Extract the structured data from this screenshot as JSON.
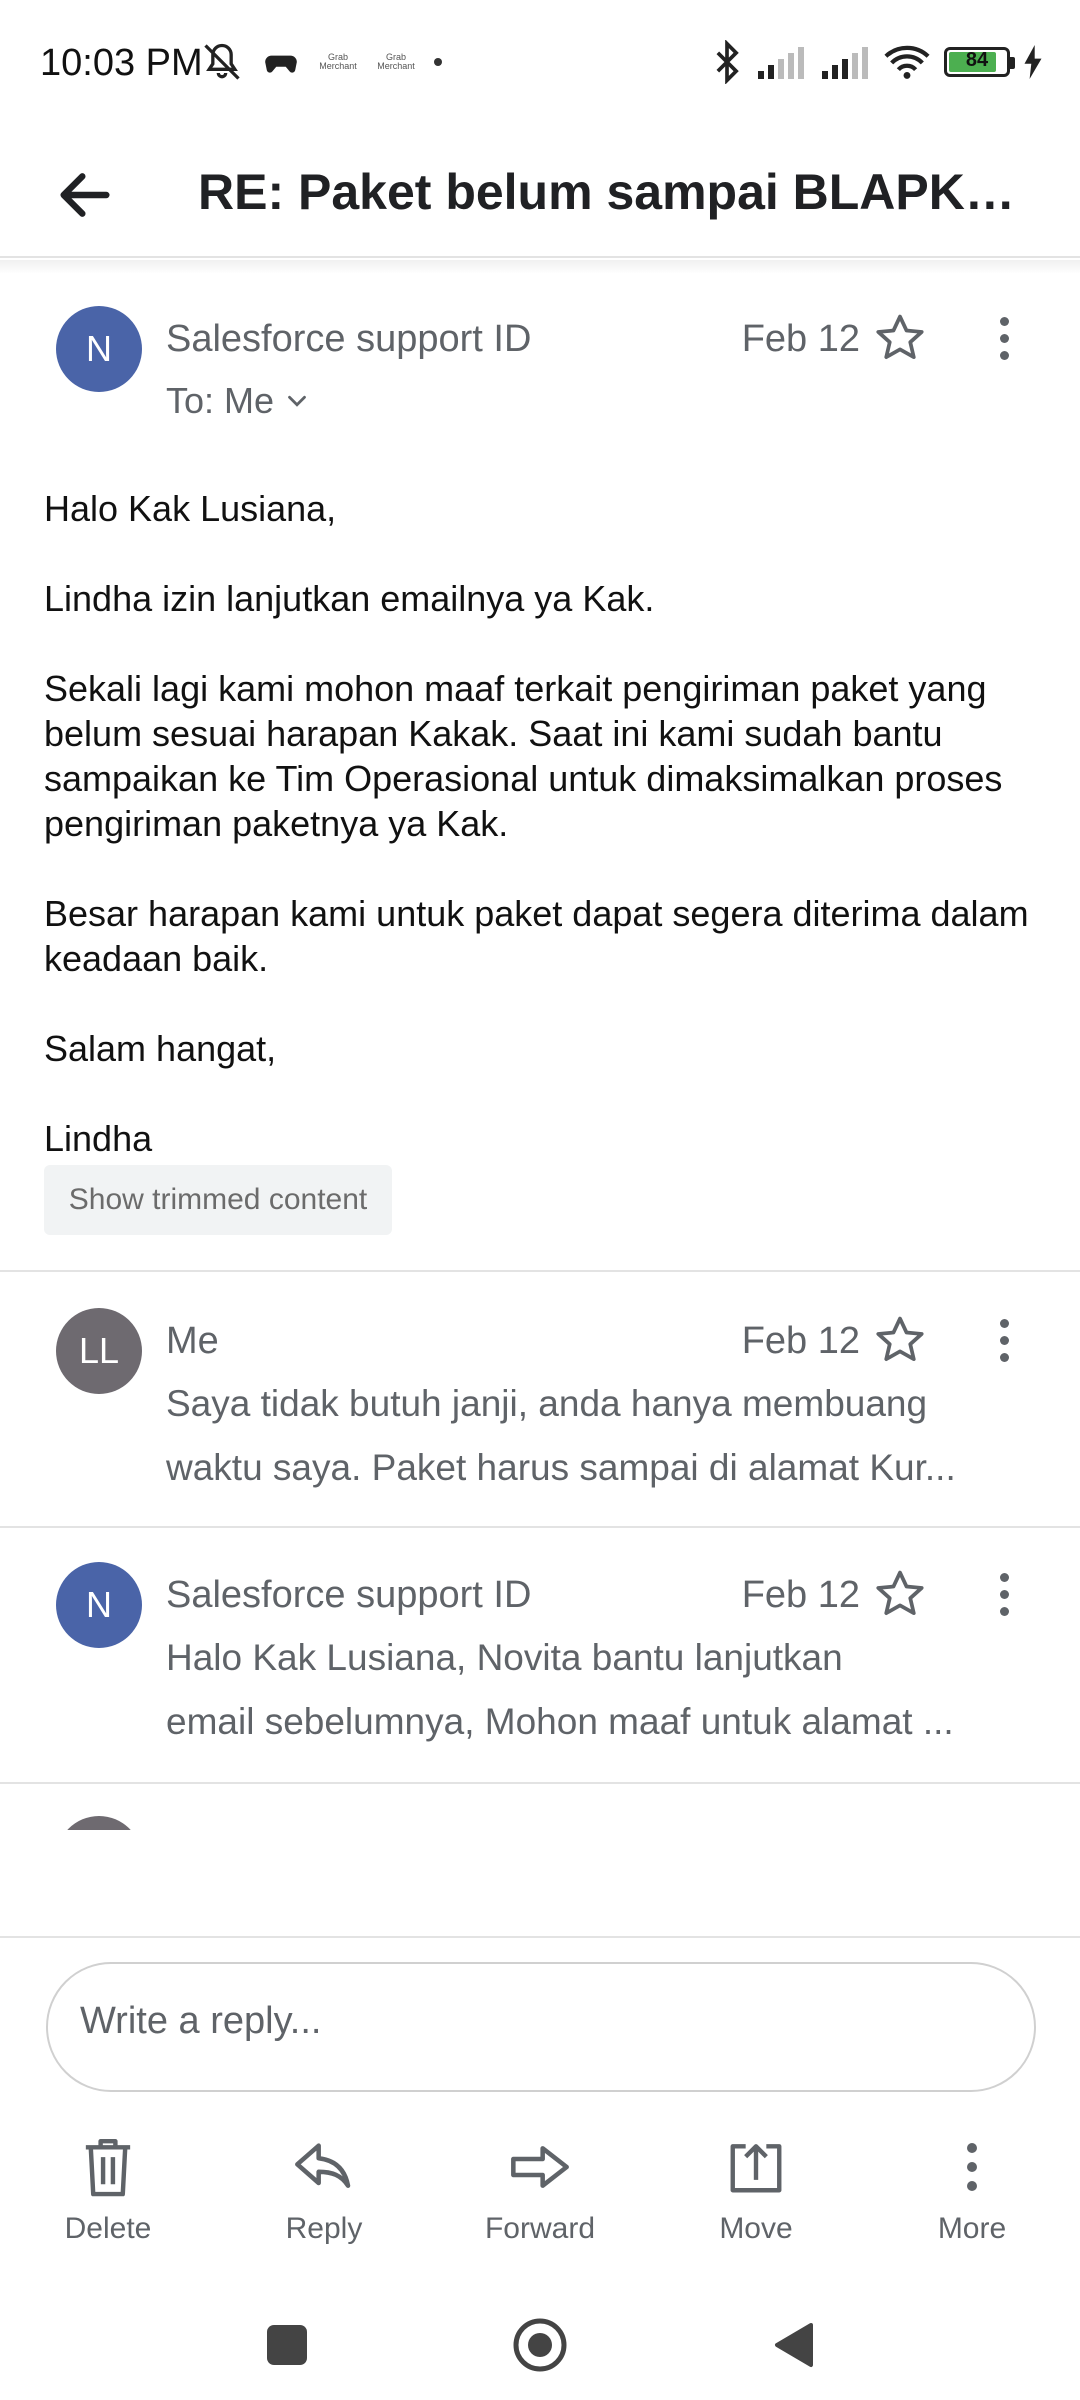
{
  "status_bar": {
    "time": "10:03 PM",
    "notif_labels": [
      "Grab Merchant",
      "Grab Merchant"
    ],
    "battery": "84",
    "icons": [
      "mute-icon",
      "game-controller-icon",
      "bluetooth-icon",
      "signal-icon",
      "signal-icon",
      "wifi-icon",
      "battery-icon",
      "charging-icon"
    ]
  },
  "app_bar": {
    "title": "RE: Paket belum sampai BLAPK25...",
    "back_icon": "arrow-left-icon"
  },
  "expanded_message": {
    "avatar": "N",
    "avatar_color": "#4a64a8",
    "sender": "Salesforce support ID",
    "date": "Feb 12",
    "to": "To: Me",
    "body": [
      "Halo Kak Lusiana,",
      "Lindha izin lanjutkan emailnya ya Kak.",
      "Sekali lagi kami mohon maaf terkait pengiriman paket yang belum sesuai harapan Kakak. Saat ini kami sudah bantu sampaikan ke Tim Operasional untuk dimaksimalkan proses pengiriman paketnya ya Kak.",
      "Besar harapan kami untuk paket dapat segera diterima dalam keadaan baik.",
      "Salam hangat,",
      "Lindha"
    ],
    "show_trimmed": "Show trimmed content"
  },
  "collapsed_messages": [
    {
      "avatar": "LL",
      "avatar_color": "#6e6a70",
      "sender": "Me",
      "date": "Feb 12",
      "snippet_line1": "Saya tidak butuh janji, anda hanya membuang",
      "snippet_line2": "waktu saya. Paket harus sampai di alamat Kur..."
    },
    {
      "avatar": "N",
      "avatar_color": "#4a64a8",
      "sender": "Salesforce support ID",
      "date": "Feb 12",
      "snippet_line1": "Halo Kak Lusiana, Novita bantu lanjutkan",
      "snippet_line2": "email sebelumnya, Mohon maaf untuk alamat ..."
    }
  ],
  "reply": {
    "placeholder": "Write a reply..."
  },
  "actions": {
    "delete": "Delete",
    "reply": "Reply",
    "forward": "Forward",
    "move": "Move",
    "more": "More"
  }
}
